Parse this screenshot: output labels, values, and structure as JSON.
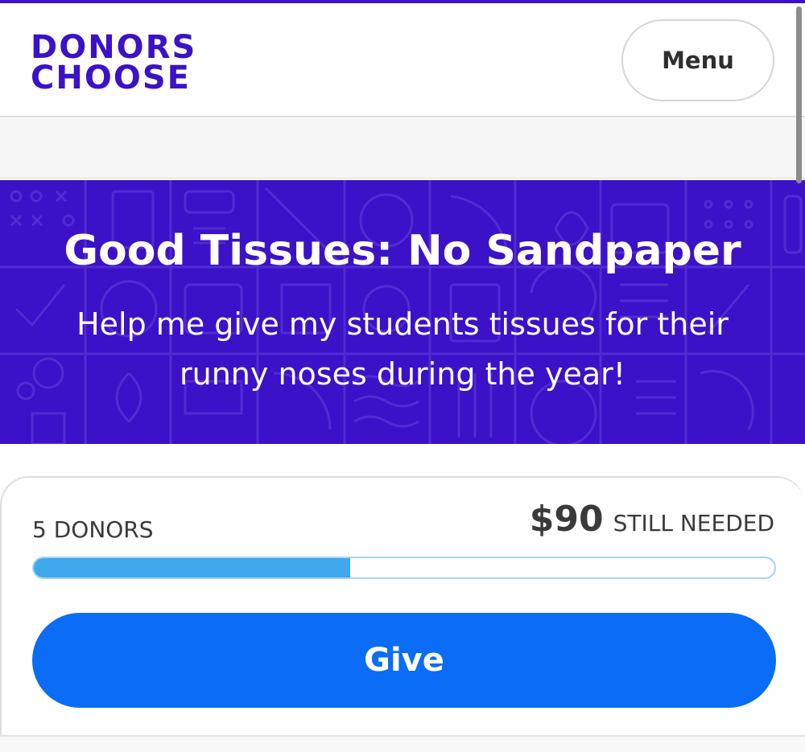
{
  "header": {
    "logo_line1": "DONORS",
    "logo_line2": "CHOOSE",
    "menu_label": "Menu"
  },
  "hero": {
    "title": "Good Tissues: No Sandpaper",
    "subtitle": "Help me give my students tissues for their runny noses during the year!"
  },
  "funding": {
    "donors_label": "5 DONORS",
    "still_needed_amount": "$90",
    "still_needed_label": "STILL NEEDED",
    "progress_fraction": 0.427,
    "give_label": "Give"
  },
  "colors": {
    "brand_purple": "#3b12c7",
    "progress_blue": "#3fa8ec",
    "button_blue": "#0b6cf5"
  }
}
